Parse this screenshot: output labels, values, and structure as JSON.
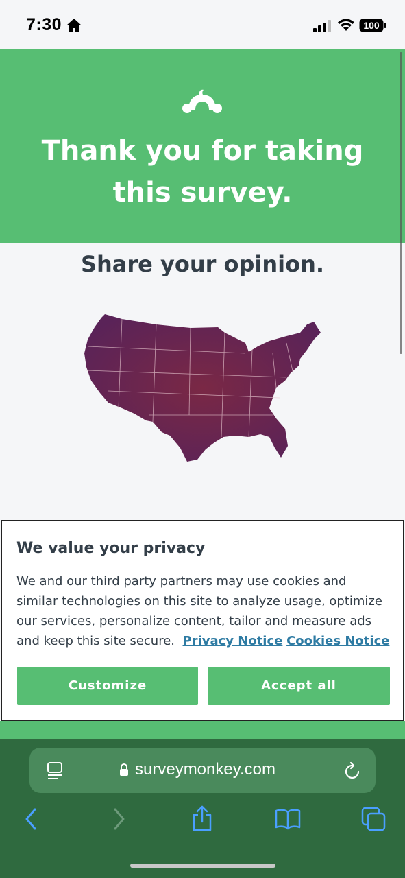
{
  "status": {
    "time": "7:30",
    "battery": "100"
  },
  "hero": {
    "title": "Thank you for taking this survey.",
    "background": "#57be73"
  },
  "main": {
    "subtitle": "Share your opinion."
  },
  "privacy": {
    "title": "We value your privacy",
    "body": "We and our third party partners may use cookies and similar technologies on this site to analyze usage, optimize our services, personalize content, tailor and measure ads and keep this site secure.",
    "privacy_link": "Privacy Notice",
    "cookies_link": "Cookies Notice",
    "customize_label": "Customize",
    "accept_label": "Accept all",
    "button_color": "#57be73",
    "link_color": "#2e7ba3"
  },
  "browser": {
    "url": "surveymonkey.com",
    "icons": [
      "tabs-overview-icon",
      "lock-icon",
      "reload-icon",
      "back-icon",
      "forward-icon",
      "share-icon",
      "bookmarks-icon",
      "tabs-icon"
    ]
  }
}
